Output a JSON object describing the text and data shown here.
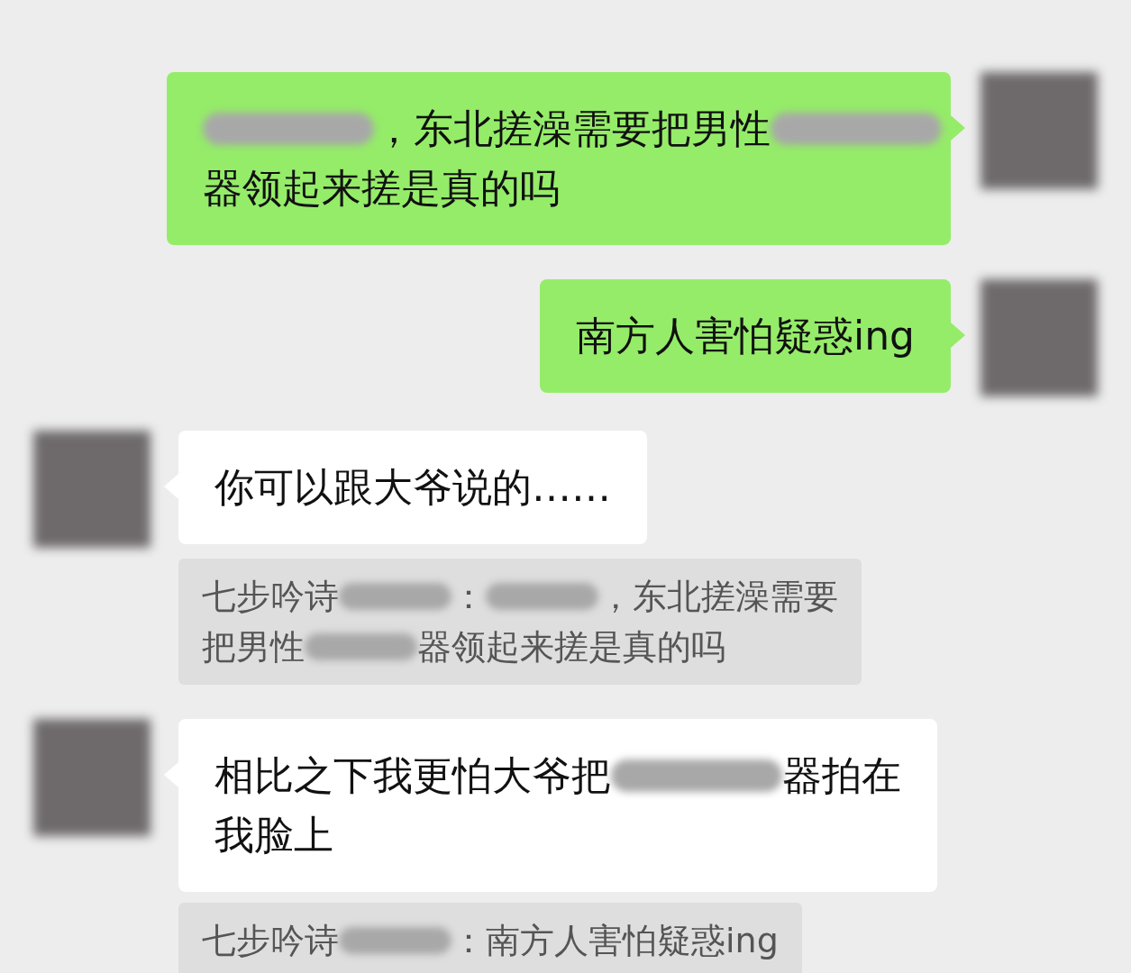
{
  "messages": [
    {
      "from_me": true,
      "lines": [
        [
          {
            "kind": "redacted"
          },
          {
            "kind": "text",
            "text": "，东北搓澡需要把男性"
          },
          {
            "kind": "redacted"
          }
        ],
        [
          {
            "kind": "text",
            "text": "器领起来搓是真的吗"
          }
        ]
      ]
    },
    {
      "from_me": true,
      "lines": [
        [
          {
            "kind": "text",
            "text": "南方人害怕疑惑ing"
          }
        ]
      ]
    },
    {
      "from_me": false,
      "lines": [
        [
          {
            "kind": "text",
            "text": "你可以跟大爷说的……"
          }
        ]
      ],
      "quote": {
        "lines": [
          [
            {
              "kind": "text",
              "text": "七步吟诗"
            },
            {
              "kind": "redacted"
            },
            {
              "kind": "text",
              "text": "："
            },
            {
              "kind": "redacted"
            },
            {
              "kind": "text",
              "text": "，东北搓澡需要"
            }
          ],
          [
            {
              "kind": "text",
              "text": "把男性"
            },
            {
              "kind": "redacted"
            },
            {
              "kind": "text",
              "text": "器领起来搓是真的吗"
            }
          ]
        ]
      }
    },
    {
      "from_me": false,
      "lines": [
        [
          {
            "kind": "text",
            "text": "相比之下我更怕大爷把"
          },
          {
            "kind": "redacted"
          },
          {
            "kind": "text",
            "text": "器拍在"
          }
        ],
        [
          {
            "kind": "text",
            "text": "我脸上"
          }
        ]
      ],
      "quote": {
        "lines": [
          [
            {
              "kind": "text",
              "text": "七步吟诗"
            },
            {
              "kind": "redacted"
            },
            {
              "kind": "text",
              "text": "：南方人害怕疑惑ing"
            }
          ]
        ]
      }
    }
  ]
}
